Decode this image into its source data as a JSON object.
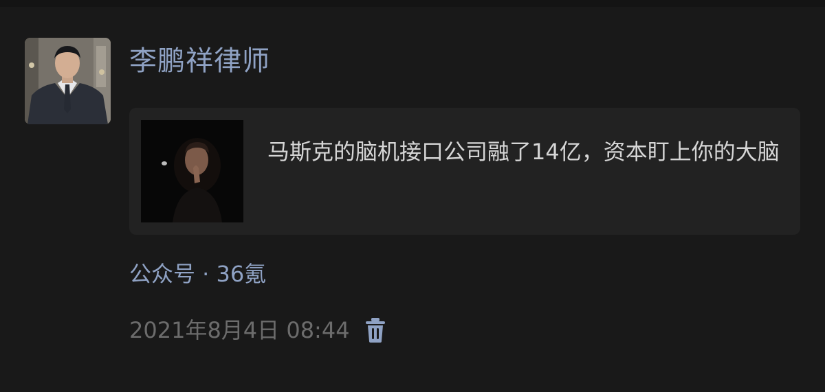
{
  "post": {
    "author": "李鹏祥律师",
    "article": {
      "title": "马斯克的脑机接口公司融了14亿，资本盯上你的大脑"
    },
    "source": "公众号 · 36氪",
    "timestamp": "2021年8月4日 08:44"
  },
  "icons": {
    "delete": "trash-icon",
    "avatar": "avatar-photo",
    "thumbnail": "article-thumbnail"
  },
  "colors": {
    "background": "#191919",
    "card_background": "#222222",
    "link_blue": "#8fa2c4",
    "title_text": "#d6d6d6",
    "muted_text": "#6c6c6c"
  }
}
